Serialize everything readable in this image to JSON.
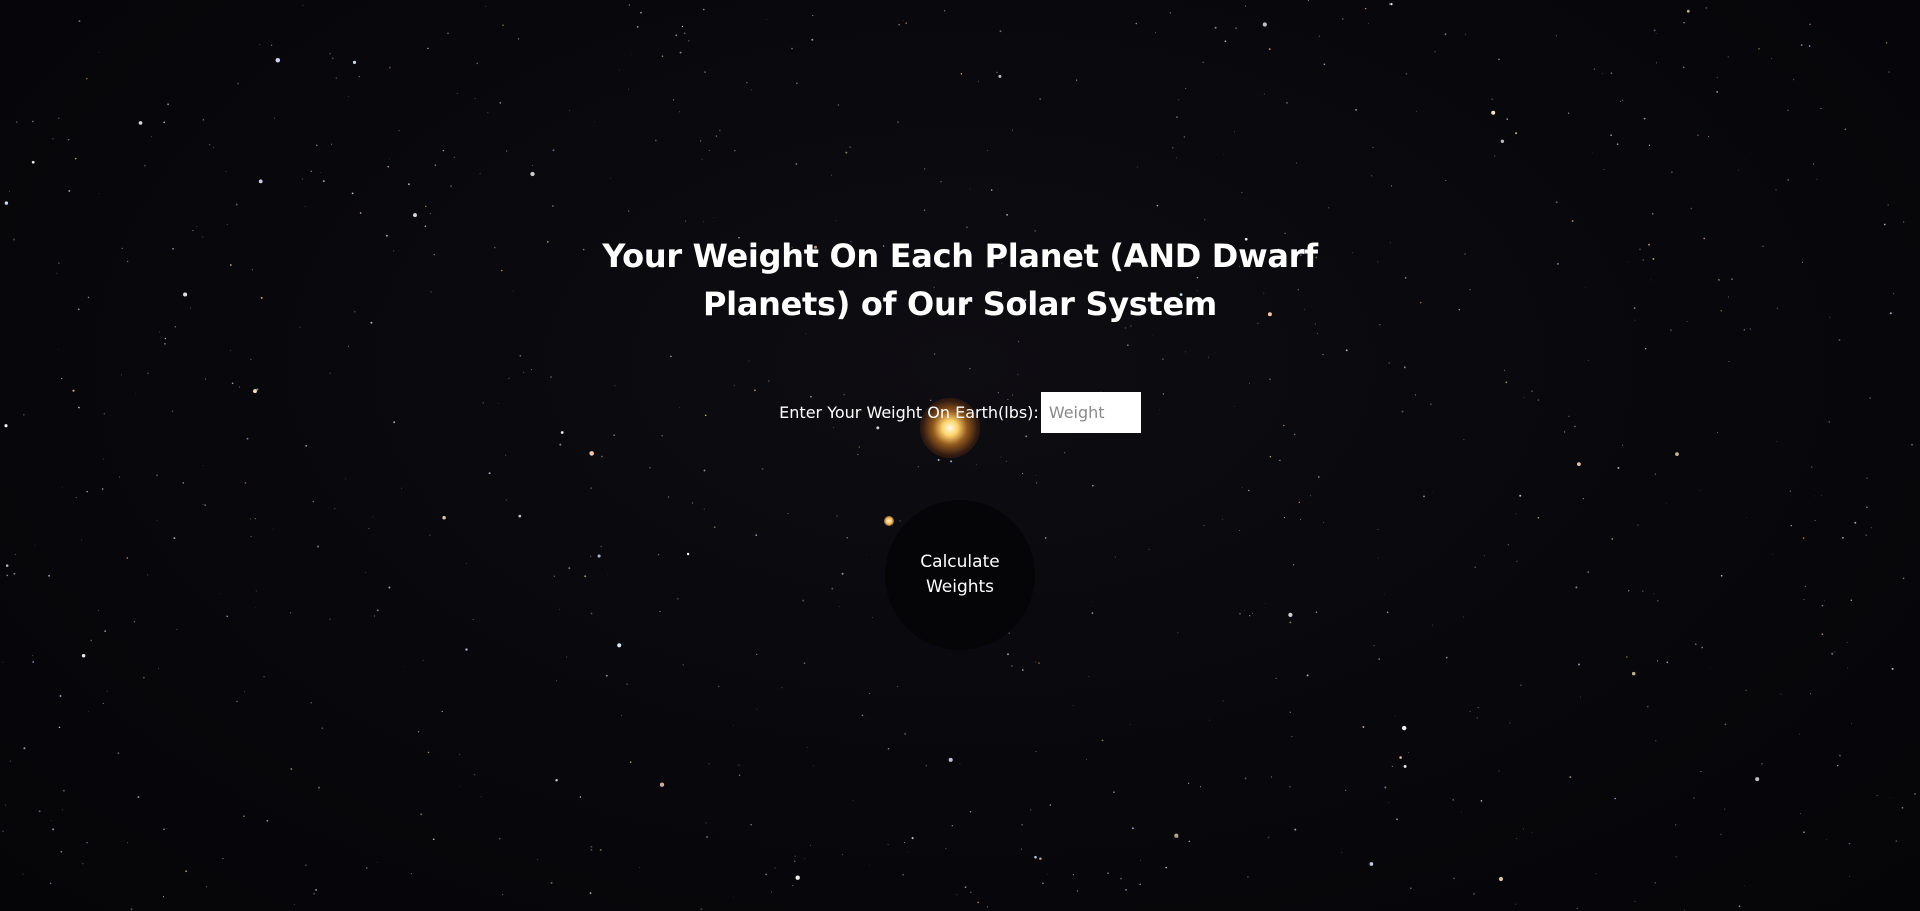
{
  "page": {
    "title": "Your Weight On Each Planet (AND Dwarf Planets) of Our Solar System"
  },
  "weight_form": {
    "label": "Enter Your Weight On Earth(lbs):",
    "input_value": "",
    "input_placeholder": "Weight"
  },
  "calculate_button": {
    "label": "Calculate Weights"
  },
  "colors": {
    "background": "#07070b",
    "text": "#ffffff",
    "button_background": "#050507",
    "input_background": "#ffffff"
  }
}
